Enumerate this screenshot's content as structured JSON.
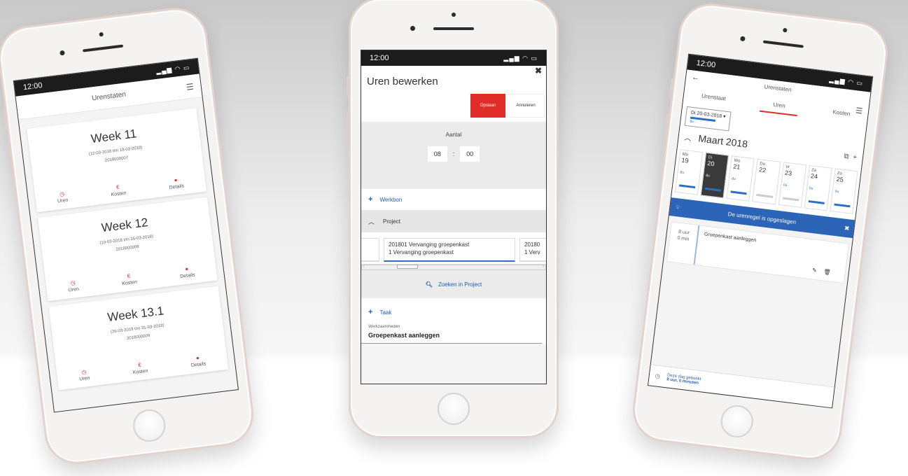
{
  "status_bar": {
    "time": "12:00",
    "icons": "signal wifi battery"
  },
  "phone1": {
    "header_title": "Urenstaten",
    "weeks": [
      {
        "title": "Week 11",
        "range": "(12-03-2018 t/m 18-03-2018)",
        "number": "2018000007"
      },
      {
        "title": "Week 12",
        "range": "(19-03-2018 t/m 25-03-2018)",
        "number": "2018000008"
      },
      {
        "title": "Week 13.1",
        "range": "(26-03-2018 t/m 31-03-2018)",
        "number": "2018000009"
      }
    ],
    "actions": {
      "uren": "Uren",
      "kosten": "Kosten",
      "details": "Details"
    }
  },
  "phone2": {
    "title": "Uren bewerken",
    "save": "Opslaan",
    "cancel": "Annuleren",
    "aantal_label": "Aantal",
    "hours": "08",
    "separator": ":",
    "minutes": "00",
    "werkbon": "Werkbon",
    "project_label": "Project",
    "project_cards": [
      {
        "line1": "201801 Vervanging groepenkast",
        "line2": "1 Vervanging groepenkast"
      },
      {
        "line1": "20180",
        "line2": "1 Verv"
      }
    ],
    "zoeken": "Zoeken in Project",
    "taak": "Taak",
    "werkzaamheden_label": "Werkzaamheden",
    "werkzaamheden_value": "Groepenkast aanleggen"
  },
  "phone3": {
    "header_title": "Urenstaten",
    "tabs": [
      "Urenstaat",
      "Uren",
      "Kosten"
    ],
    "date_select": "Di 20-03-2018",
    "date_sub": "8u",
    "month": "Maart 2018",
    "days": [
      {
        "dow": "Ma",
        "num": "19",
        "hours": "8u"
      },
      {
        "dow": "Di",
        "num": "20",
        "hours": "8u"
      },
      {
        "dow": "Wo",
        "num": "21",
        "hours": "8u"
      },
      {
        "dow": "Do",
        "num": "22",
        "hours": ""
      },
      {
        "dow": "Vr",
        "num": "23",
        "hours": "0u"
      },
      {
        "dow": "Za",
        "num": "24",
        "hours": "0u"
      },
      {
        "dow": "Zo",
        "num": "25",
        "hours": "0u"
      }
    ],
    "notice": "De urenregel is opgeslagen",
    "entry_hours": "8 uur",
    "entry_minutes": "0 min",
    "entry_task": "Groepenkast aanleggen",
    "footer_line1": "Deze dag geboekt",
    "footer_line2": "8 uur, 0 minuten"
  }
}
